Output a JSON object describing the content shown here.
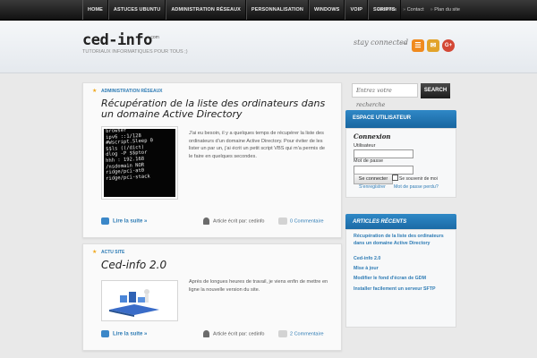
{
  "nav": {
    "items": [
      "HOME",
      "ASTUCES UBUNTU",
      "ADMINISTRATION RÉSEAUX",
      "PERSONNALISATION",
      "WINDOWS",
      "VOIP",
      "SCRIPTS"
    ],
    "util": [
      "Archives",
      "Contact",
      "Plan du site"
    ]
  },
  "header": {
    "logo": "ced-info",
    "logo_suffix": ".com",
    "tagline": "TUTORIAUX INFORMATIQUES POUR TOUS ;)",
    "stay_connected": "stay connected"
  },
  "posts": [
    {
      "category": "ADMINISTRATION RÉSEAUX",
      "title": "Récupération de la liste des ordinateurs dans un domaine Active Directory",
      "excerpt": "J'ai eu besoin, il y a quelques temps de récupérer la liste des ordinateurs d'un domaine Active Directory. Pour éviter de les lister un par un, j'ai écrit un petit script VBS qui m'a permis de le faire en quelques secondes.",
      "read_more": "Lire la suite »",
      "author": "Article écrit par: cedinfo",
      "comments": "0 Commentaire"
    },
    {
      "category": "ACTU SITE",
      "title": "Ced-info 2.0",
      "excerpt": "Après de longues heures de travail, je viens enfin de mettre en ligne la nouvelle version du site.",
      "read_more": "Lire la suite »",
      "author": "Article écrit par: cedinfo",
      "comments": "2 Commentaire"
    }
  ],
  "search": {
    "placeholder": "Entrez votre recherche",
    "button": "SEARCH"
  },
  "user_widget": {
    "title": "ESPACE UTILISATEUR",
    "heading": "Connexion",
    "user_label": "Utilisateur",
    "pass_label": "Mot de passe",
    "login_button": "Se connecter",
    "remember": "Se souvenir de moi",
    "register": "S'enregistrer",
    "forgot": "Mot de passe perdu?"
  },
  "recent_widget": {
    "title": "ARTICLES RÉCENTS",
    "items": [
      "Récupération de la liste des ordinateurs dans un domaine Active Directory",
      "Ced-info 2.0",
      "Mise à jour",
      "Modifier le fond d'écran de GDM",
      "Installer facilement un serveur SFTP"
    ]
  },
  "thumb_code": [
    "browser",
    "ipv6 ::1/128",
    "#Wscript.Sleep 0",
    "$$ls ((/dict)",
    "dlog -P $$ptor",
    "hhh : 192.168",
    "/nsdomain NOR",
    "ridge/pci-at0",
    "ridge/pci-stack"
  ],
  "colors": {
    "accent": "#2f7cb5",
    "nav_bg": "#1a1a1a"
  }
}
